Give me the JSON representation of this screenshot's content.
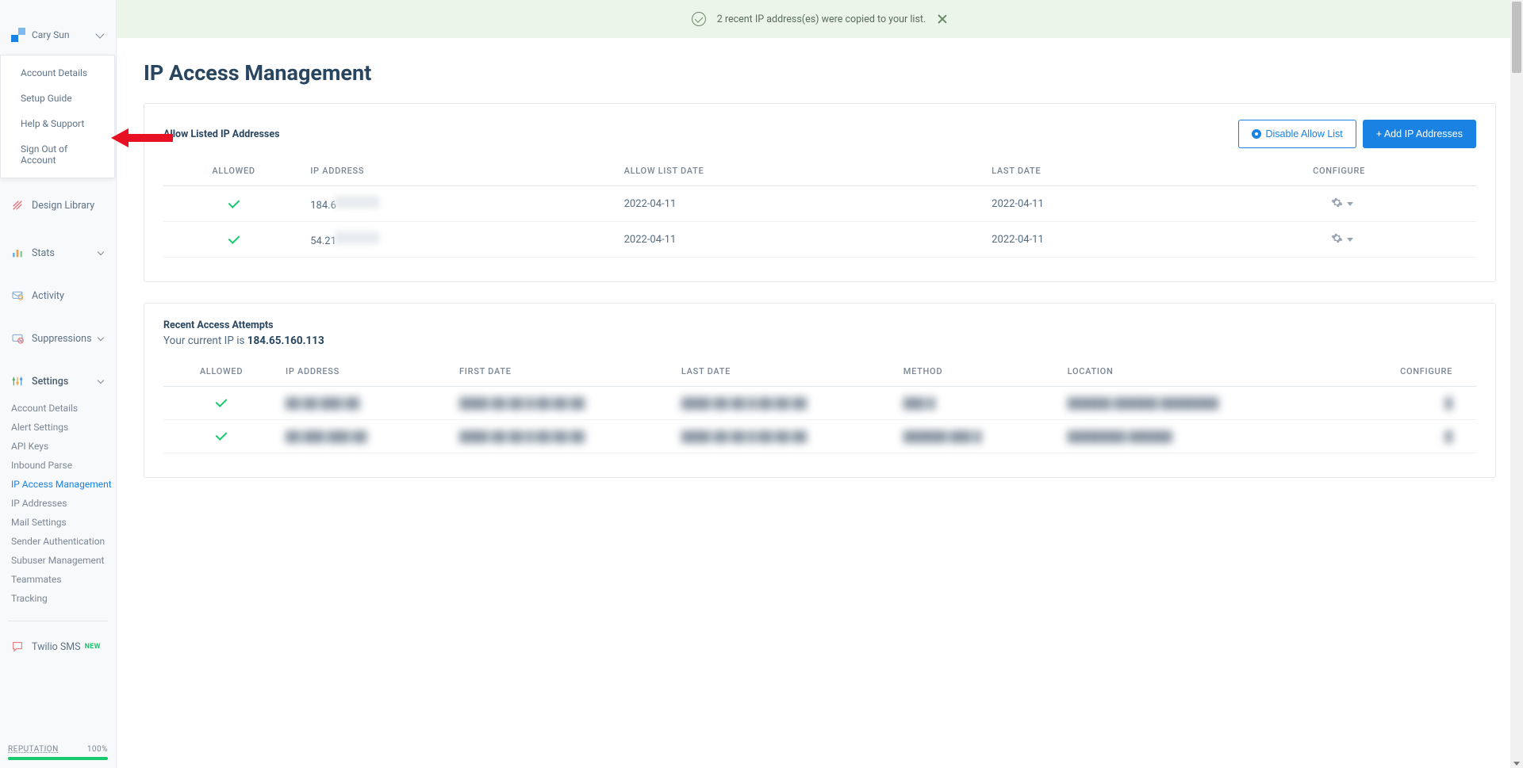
{
  "account": {
    "name": "Cary Sun"
  },
  "dropdown": {
    "account_details": "Account Details",
    "setup_guide": "Setup Guide",
    "help_support": "Help & Support",
    "sign_out": "Sign Out of Account"
  },
  "nav": {
    "design_library": "Design Library",
    "stats": "Stats",
    "activity": "Activity",
    "suppressions": "Suppressions",
    "settings": "Settings",
    "twilio_sms": "Twilio SMS",
    "badge_new": "NEW"
  },
  "settings_sub": {
    "account_details": "Account Details",
    "alert_settings": "Alert Settings",
    "api_keys": "API Keys",
    "inbound_parse": "Inbound Parse",
    "ip_access_management": "IP Access Management",
    "ip_addresses": "IP Addresses",
    "mail_settings": "Mail Settings",
    "sender_authentication": "Sender Authentication",
    "subuser_management": "Subuser Management",
    "teammates": "Teammates",
    "tracking": "Tracking"
  },
  "reputation": {
    "label": "REPUTATION",
    "value": "100%"
  },
  "banner": {
    "text": "2 recent IP address(es) were copied to your list."
  },
  "page": {
    "title": "IP Access Management"
  },
  "allow_card": {
    "title": "Allow Listed IP Addresses",
    "disable_btn": "Disable Allow List",
    "add_btn": "+ Add IP Addresses",
    "cols": {
      "allowed": "ALLOWED",
      "ip": "IP ADDRESS",
      "allow_date": "ALLOW LIST DATE",
      "last_date": "LAST DATE",
      "configure": "CONFIGURE"
    },
    "rows": [
      {
        "ip_prefix": "184.6",
        "allow_date": "2022-04-11",
        "last_date": "2022-04-11"
      },
      {
        "ip_prefix": "54.21",
        "allow_date": "2022-04-11",
        "last_date": "2022-04-11"
      }
    ]
  },
  "recent_card": {
    "title": "Recent Access Attempts",
    "current_ip_label": "Your current IP is ",
    "current_ip": "184.65.160.113",
    "cols": {
      "allowed": "ALLOWED",
      "ip": "IP ADDRESS",
      "first_date": "FIRST DATE",
      "last_date": "LAST DATE",
      "method": "METHOD",
      "location": "LOCATION",
      "configure": "CONFIGURE"
    },
    "rows": [
      {
        "ip": "██.██.███.██",
        "first": "████-██-██ █:██:██ ██",
        "last": "████-██-██ █:██:██ ██",
        "method": "███ █",
        "location": "██████ ██████ ████████"
      },
      {
        "ip": "██.███.███.██",
        "first": "████-██-██ █:██:██ ██",
        "last": "████-██-██ █:██:██ ██",
        "method": "██████ ███ █",
        "location": "████████ ██████"
      }
    ]
  }
}
